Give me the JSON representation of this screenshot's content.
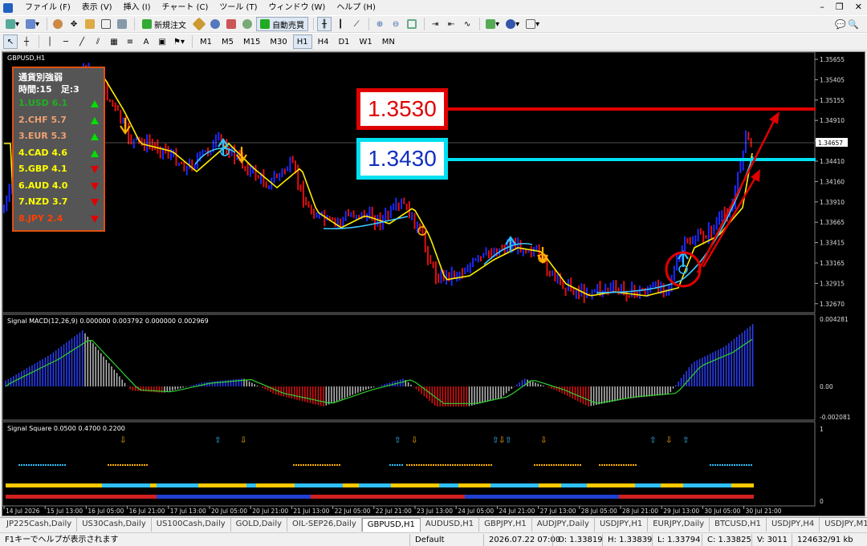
{
  "menu": [
    "ファイル (F)",
    "表示 (V)",
    "挿入 (I)",
    "チャート (C)",
    "ツール (T)",
    "ウィンドウ (W)",
    "ヘルプ (H)"
  ],
  "toolbar": {
    "new_order": "新規注文",
    "auto_trade": "自動売買",
    "timeframes": [
      "M1",
      "M5",
      "M15",
      "M30",
      "H1",
      "H4",
      "D1",
      "W1",
      "MN"
    ],
    "active_timeframe": "H1"
  },
  "chart": {
    "title": "GBPUSD,H1",
    "price_labels": [
      "1.35655",
      "1.35405",
      "1.35155",
      "1.34910",
      "1.34657",
      "1.34410",
      "1.34160",
      "1.33910",
      "1.33665",
      "1.33415",
      "1.33165",
      "1.32915",
      "1.32670"
    ],
    "current_price": "1.34657",
    "macd_title": "Signal MACD(12,26,9) 0.000000 0.003792 0.000000 0.002969",
    "macd_labels": [
      "0.004281",
      "0.00",
      "-0.002081"
    ],
    "square_title": "Signal Square 0.0500 0.4700 0.2200",
    "square_labels": [
      "1",
      "0"
    ],
    "time_labels": [
      "14 Jul 2026",
      "15 Jul 13:00",
      "16 Jul 05:00",
      "16 Jul 21:00",
      "17 Jul 13:00",
      "20 Jul 05:00",
      "20 Jul 21:00",
      "21 Jul 13:00",
      "22 Jul 05:00",
      "22 Jul 21:00",
      "23 Jul 13:00",
      "24 Jul 05:00",
      "24 Jul 21:00",
      "27 Jul 13:00",
      "28 Jul 05:00",
      "28 Jul 21:00",
      "29 Jul 13:00",
      "30 Jul 05:00",
      "30 Jul 21:00"
    ]
  },
  "strength": {
    "title": "通貨別強弱",
    "subtitle": "時間:15　足:3",
    "items": [
      {
        "label": "1.USD 6.1",
        "color": "#20b020",
        "dir": "up"
      },
      {
        "label": "2.CHF 5.7",
        "color": "#f0a070",
        "dir": "up"
      },
      {
        "label": "3.EUR 5.3",
        "color": "#f0a070",
        "dir": "up"
      },
      {
        "label": "4.CAD 4.6",
        "color": "#ffff00",
        "dir": "up"
      },
      {
        "label": "5.GBP 4.1",
        "color": "#ffff00",
        "dir": "down"
      },
      {
        "label": "6.AUD 4.0",
        "color": "#ffff00",
        "dir": "down"
      },
      {
        "label": "7.NZD 3.7",
        "color": "#ffff00",
        "dir": "down"
      },
      {
        "label": "8.JPY 2.4",
        "color": "#ff4000",
        "dir": "down"
      }
    ]
  },
  "annotations": {
    "target_red": "1.3530",
    "target_cyan": "1.3430"
  },
  "tabs": [
    "JP225Cash,Daily",
    "US30Cash,Daily",
    "US100Cash,Daily",
    "GOLD,Daily",
    "OIL-SEP26,Daily",
    "GBPUSD,H1",
    "AUDUSD,H1",
    "GBPJPY,H1",
    "AUDJPY,Daily",
    "USDJPY,H1",
    "EURJPY,Daily",
    "BTCUSD,H1",
    "USDJPY,H4",
    "USDJPY,M1"
  ],
  "active_tab": "GBPUSD,H1",
  "status": {
    "help": "F1キーでヘルプが表示されます",
    "profile": "Default",
    "datetime": "2026.07.22 07:00",
    "open": "O: 1.33819",
    "high": "H: 1.33839",
    "low": "L: 1.33794",
    "close": "C: 1.33825",
    "volume": "V: 3011",
    "traffic": "124632/91 kb"
  }
}
